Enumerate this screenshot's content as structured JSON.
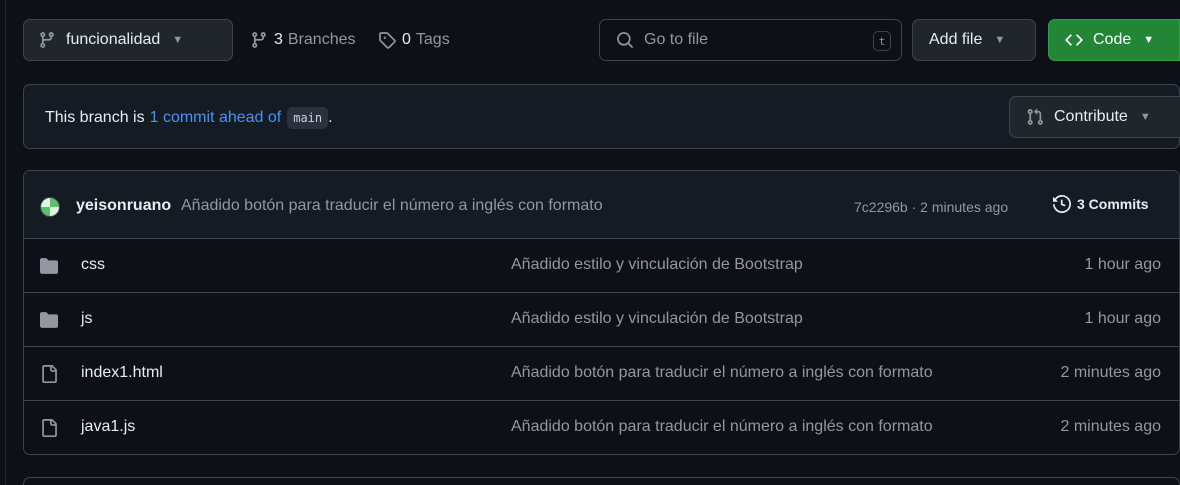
{
  "topbar": {
    "branch_name": "funcionalidad",
    "branches_count": "3",
    "branches_label": "Branches",
    "tags_count": "0",
    "tags_label": "Tags",
    "search_placeholder": "Go to file",
    "search_shortcut": "t",
    "add_file_label": "Add file",
    "code_label": "Code"
  },
  "ahead_banner": {
    "prefix": "This branch is",
    "link_text": "1 commit ahead of",
    "base_branch": "main",
    "suffix": ".",
    "contribute_label": "Contribute"
  },
  "latest_commit": {
    "author": "yeisonruano",
    "message": "Añadido botón para traducir el número a inglés con formato",
    "meta": "7c2296b · 2 minutes ago",
    "commits_label": "3 Commits"
  },
  "files": [
    {
      "type": "folder",
      "name": "css",
      "message": "Añadido estilo y vinculación de Bootstrap",
      "time": "1 hour ago"
    },
    {
      "type": "folder",
      "name": "js",
      "message": "Añadido estilo y vinculación de Bootstrap",
      "time": "1 hour ago"
    },
    {
      "type": "file",
      "name": "index1.html",
      "message": "Añadido botón para traducir el número a inglés con formato",
      "time": "2 minutes ago"
    },
    {
      "type": "file",
      "name": "java1.js",
      "message": "Añadido botón para traducir el número a inglés con formato",
      "time": "2 minutes ago"
    }
  ],
  "colors": {
    "background": "#0d1117",
    "accent_link": "#4493f8",
    "code_button": "#238636",
    "border": "#3d444d"
  }
}
